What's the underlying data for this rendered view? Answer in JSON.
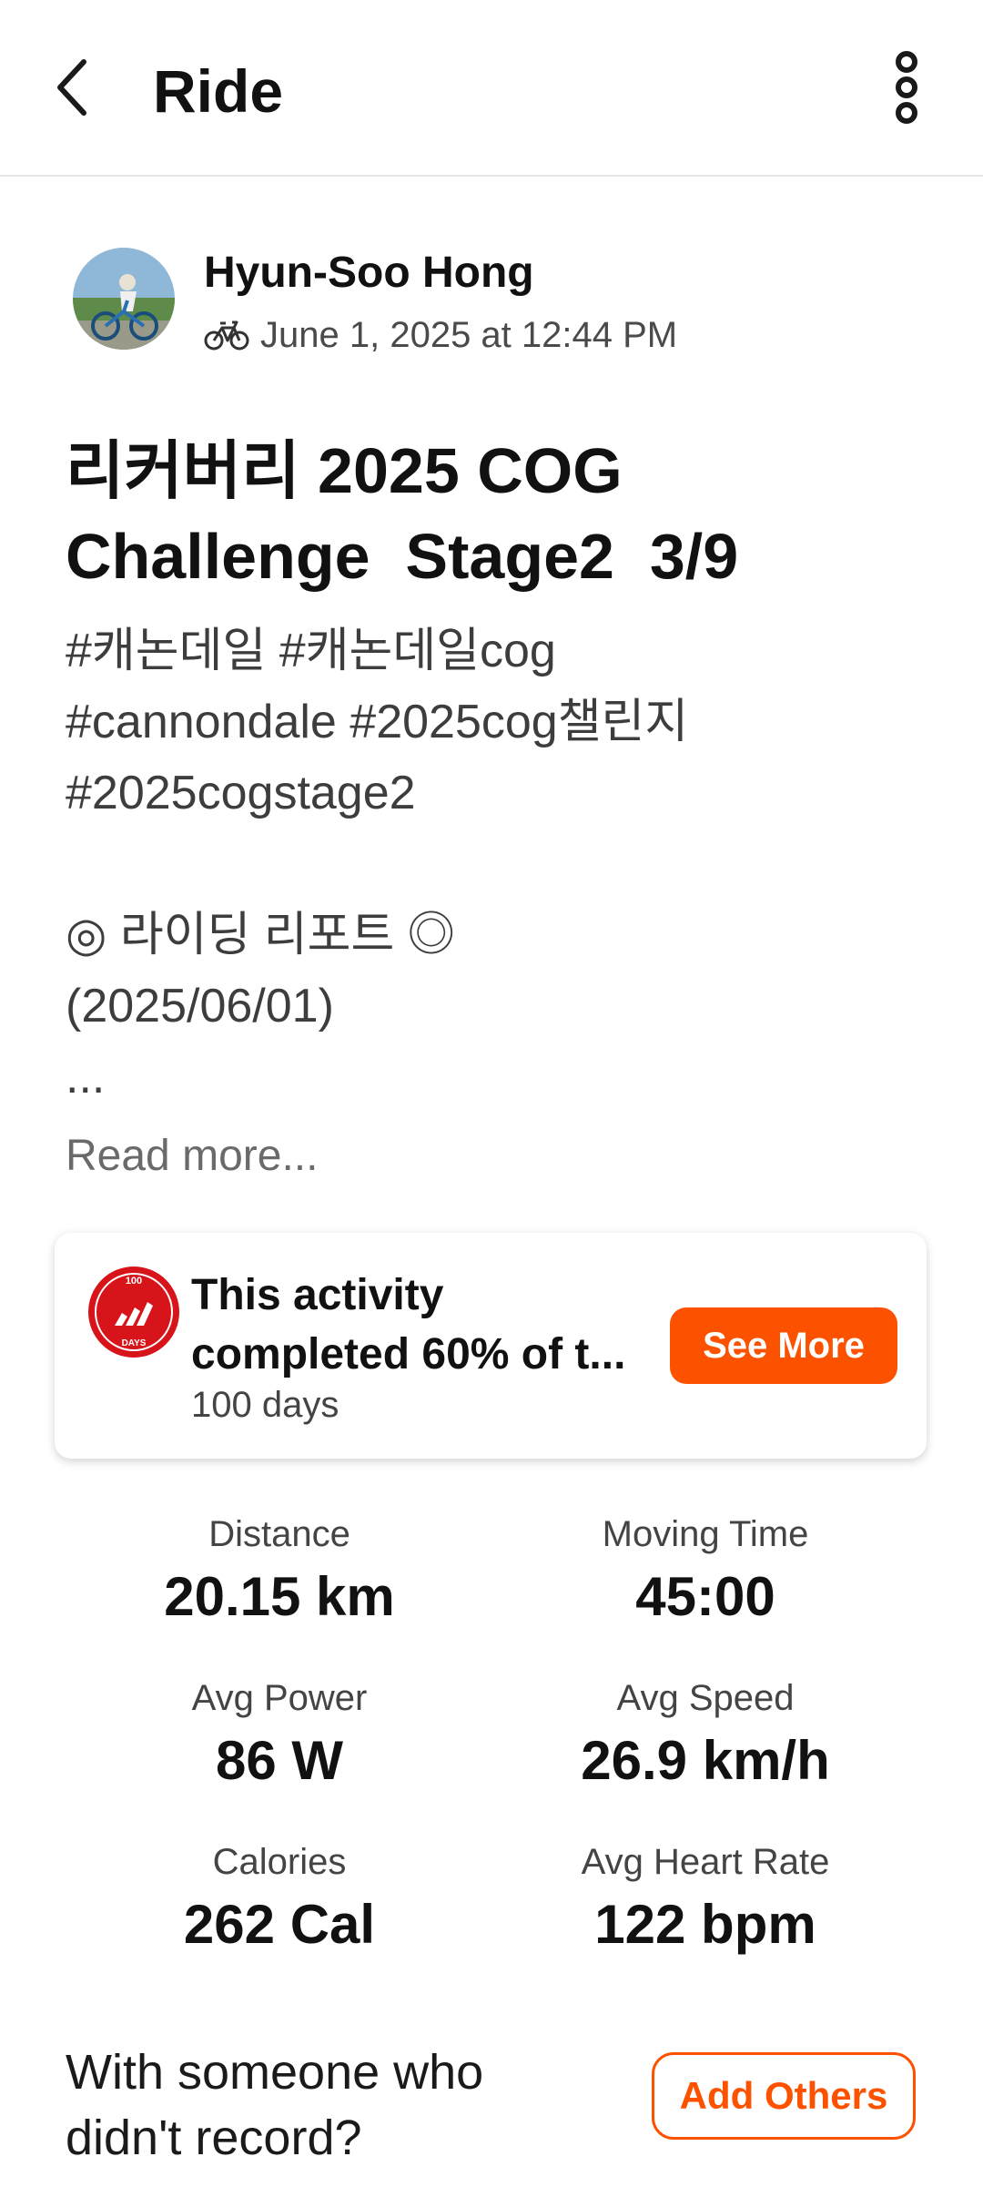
{
  "header": {
    "title": "Ride",
    "back_icon": "chevron-left-icon",
    "menu_icon": "more-vertical-icon"
  },
  "activity": {
    "athlete_name": "Hyun-Soo Hong",
    "sport_icon": "bike-icon",
    "timestamp": "June 1, 2025 at 12:44 PM",
    "title": "리커버리 2025 COG\nChallenge  Stage2  3/9",
    "description": "#캐논데일 #캐논데일cog\n#cannondale #2025cog챌린지\n#2025cogstage2\n\n◎ 라이딩 리포트 ◎\n(2025/06/01)\n...",
    "read_more": "Read more..."
  },
  "challenge": {
    "badge_text": "100",
    "badge_subtext": "DAYS",
    "line1": "This activity",
    "line2": "completed 60% of t...",
    "subtitle": "100 days",
    "button": "See More"
  },
  "stats": [
    {
      "label": "Distance",
      "value": "20.15 km"
    },
    {
      "label": "Moving Time",
      "value": "45:00"
    },
    {
      "label": "Avg Power",
      "value": "86 W"
    },
    {
      "label": "Avg Speed",
      "value": "26.9 km/h"
    },
    {
      "label": "Calories",
      "value": "262 Cal"
    },
    {
      "label": "Avg Heart Rate",
      "value": "122 bpm"
    }
  ],
  "footer_prompt": {
    "text": "With someone who didn't record?",
    "button": "Add Others"
  },
  "colors": {
    "accent": "#fc5200",
    "badge_red": "#d7141a"
  }
}
